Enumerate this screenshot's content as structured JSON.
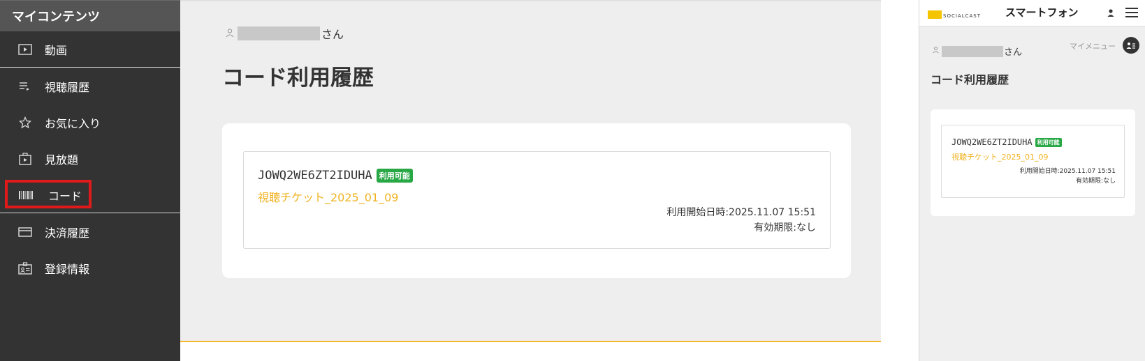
{
  "sidebar": {
    "title": "マイコンテンツ",
    "items": [
      {
        "label": "動画",
        "icon": "play-icon"
      },
      {
        "label": "視聴履歴",
        "icon": "history-list-icon"
      },
      {
        "label": "お気に入り",
        "icon": "star-icon"
      },
      {
        "label": "見放題",
        "icon": "unlimited-play-icon"
      },
      {
        "label": "コード",
        "icon": "barcode-icon",
        "highlighted": true
      },
      {
        "label": "決済履歴",
        "icon": "credit-card-icon"
      },
      {
        "label": "登録情報",
        "icon": "id-card-icon"
      }
    ],
    "highlight_color": "#e01a1a"
  },
  "main": {
    "user_suffix": "さん",
    "page_title": "コード利用履歴",
    "card": {
      "code": "JOWQ2WE6ZT2IDUHA",
      "badge": "利用可能",
      "ticket_name": "視聴チケット_2025_01_09",
      "start_datetime": "利用開始日時:2025.11.07 15:51",
      "expiry": "有効期限:なし"
    }
  },
  "phone": {
    "logo_text": "SOCIALCAST",
    "title": "スマートフォン",
    "my_menu": "マイメニュー",
    "user_suffix": "さん",
    "page_title": "コード利用履歴",
    "card": {
      "code": "JOWQ2WE6ZT2IDUHA",
      "badge": "利用可能",
      "ticket_name": "視聴チケット_2025_01_09",
      "start_datetime": "利用開始日時:2025.11.07 15:51",
      "expiry": "有効期限:なし"
    }
  },
  "colors": {
    "accent": "#f0b323",
    "badge": "#28a745",
    "sidebar_bg": "#333333",
    "main_bg": "#eeeeee"
  }
}
